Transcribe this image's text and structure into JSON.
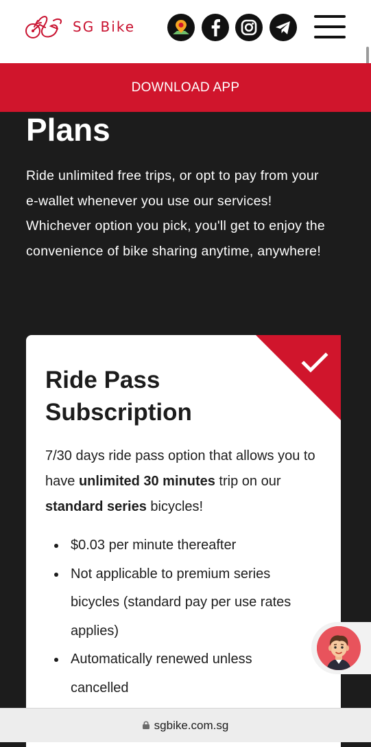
{
  "header": {
    "brand": "SG Bike",
    "social_icons": [
      "map-pin-icon",
      "facebook-icon",
      "instagram-icon",
      "telegram-icon"
    ],
    "menu_icon": "hamburger-menu-icon"
  },
  "banner": {
    "download_label": "DOWNLOAD APP"
  },
  "plans": {
    "title": "Plans",
    "description": "Ride unlimited free trips, or opt to pay from your e-wallet whenever you use our services! Whichever option you pick, you'll get to enjoy the convenience of bike sharing anytime, anywhere!"
  },
  "card": {
    "title": "Ride Pass Subscription",
    "desc_part1": "7/30 days ride pass option that allows you to have ",
    "desc_bold1": "unlimited 30 minutes",
    "desc_part2": " trip on our ",
    "desc_bold2": "standard series",
    "desc_part3": " bicycles!",
    "bullets": [
      "$0.03 per minute thereafter",
      "Not applicable to premium series bicycles (standard pay per use rates applies)",
      "Automatically renewed unless cancelled"
    ],
    "selected_icon": "checkmark-icon"
  },
  "browser": {
    "url": "sgbike.com.sg"
  },
  "colors": {
    "brand_red": "#d0152c",
    "background": "#1c1c1c"
  }
}
